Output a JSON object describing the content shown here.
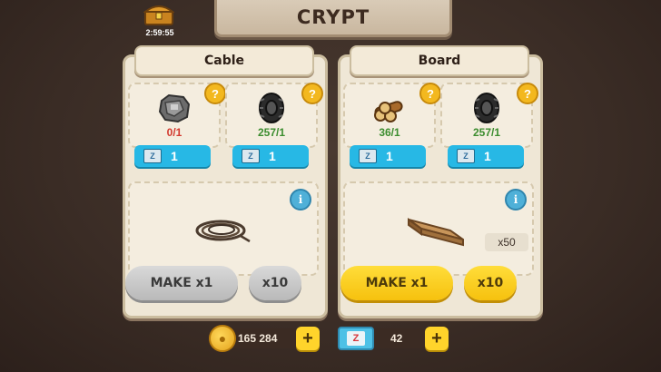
{
  "header": {
    "title": "CRYPT",
    "timer": "2:59:55"
  },
  "recipes": [
    {
      "name": "Cable",
      "ingredients": [
        {
          "icon": "metal-scrap-icon",
          "count": "0/1",
          "count_color": "#d23a2f",
          "z_cost": "1"
        },
        {
          "icon": "tire-icon",
          "count": "257/1",
          "count_color": "#3c8d2f",
          "z_cost": "1"
        }
      ],
      "result": {
        "icon": "cable-icon",
        "quantity": ""
      },
      "make_label": "MAKE x1",
      "x10_label": "x10",
      "enabled": false
    },
    {
      "name": "Board",
      "ingredients": [
        {
          "icon": "logs-icon",
          "count": "36/1",
          "count_color": "#3c8d2f",
          "z_cost": "1"
        },
        {
          "icon": "tire-icon",
          "count": "257/1",
          "count_color": "#3c8d2f",
          "z_cost": "1"
        }
      ],
      "result": {
        "icon": "board-icon",
        "quantity": "x50"
      },
      "make_label": "MAKE x1",
      "x10_label": "x10",
      "enabled": true
    }
  ],
  "currency": {
    "coins": "165 284",
    "z_tokens": "42"
  },
  "icons": {
    "help": "?",
    "info": "i",
    "plus": "+",
    "z_letter": "Z"
  },
  "colors": {
    "accent_yellow": "#ffd42b",
    "accent_blue": "#27b8e5",
    "count_red": "#d23a2f",
    "count_green": "#3c8d2f"
  }
}
